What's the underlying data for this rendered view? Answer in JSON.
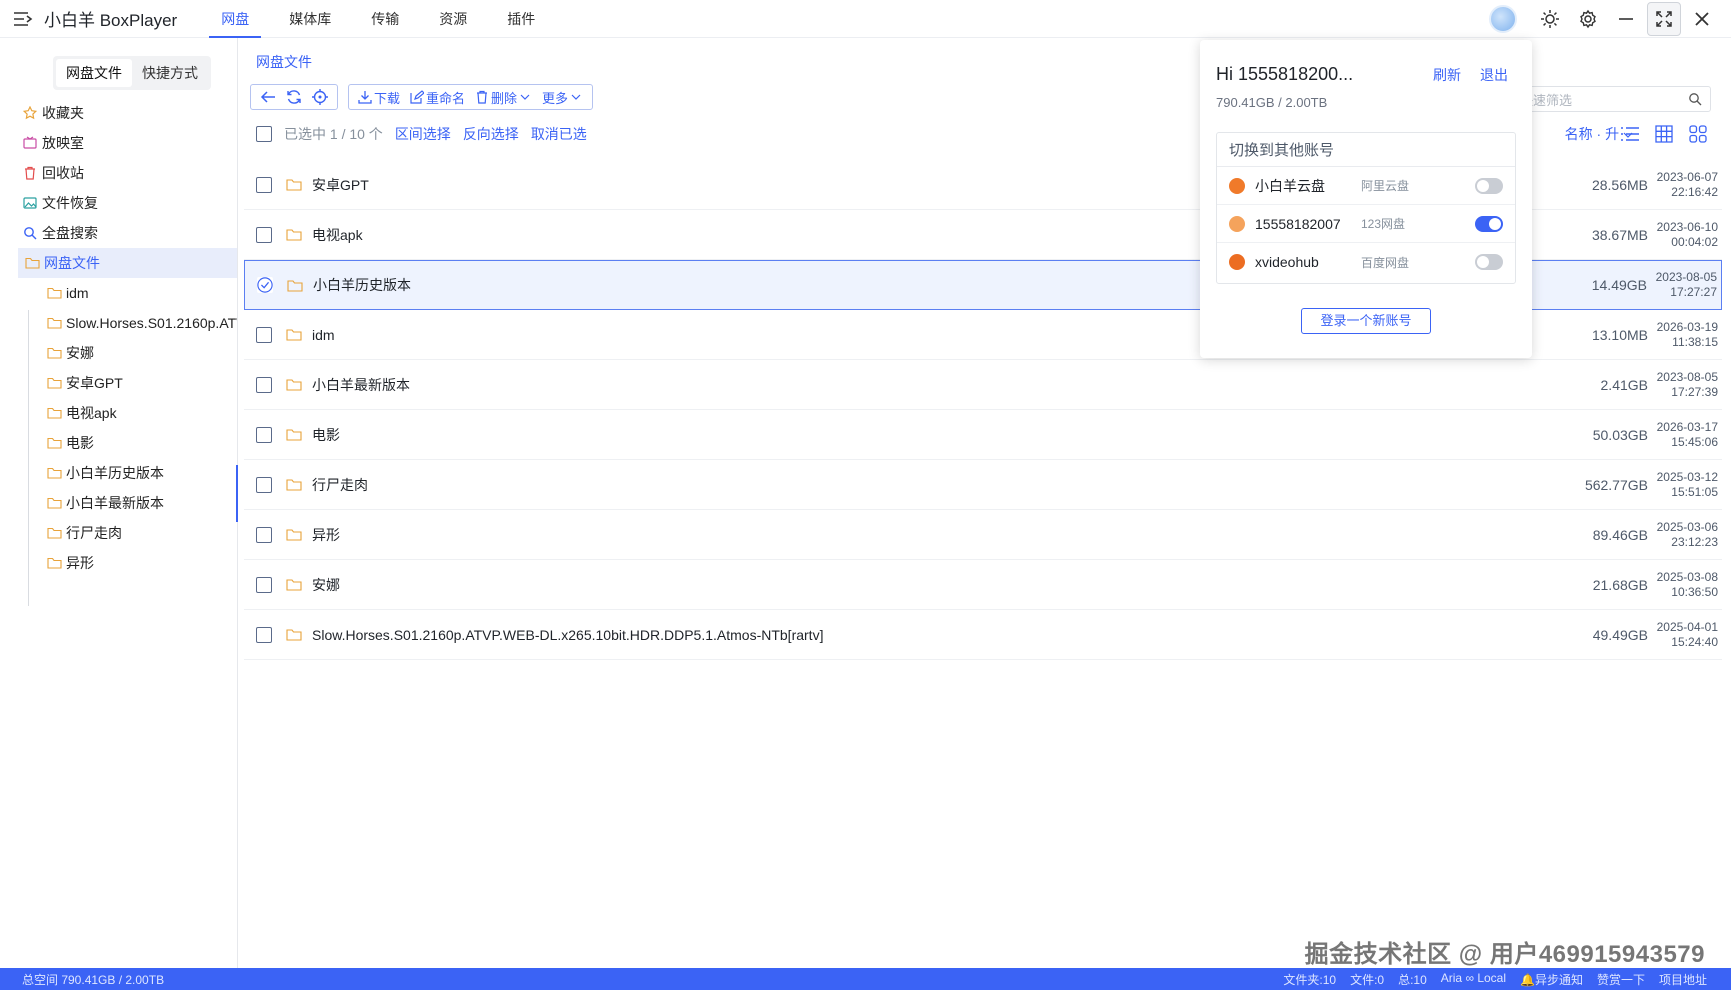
{
  "app": {
    "title": "小白羊 BoxPlayer"
  },
  "topnav": [
    "网盘",
    "媒体库",
    "传输",
    "资源",
    "插件"
  ],
  "sidebar": {
    "tabs": [
      "网盘文件",
      "快捷方式"
    ],
    "quick": [
      "收藏夹",
      "放映室",
      "回收站",
      "文件恢复",
      "全盘搜索"
    ],
    "root": "网盘文件",
    "folders": [
      "idm",
      "Slow.Horses.S01.2160p.ATVP.WEB-DL.x265.10bit.HDR.DDP5.1.Atmos-NTb[rartv]",
      "安娜",
      "安卓GPT",
      "电视apk",
      "电影",
      "小白羊历史版本",
      "小白羊最新版本",
      "行尸走肉",
      "异形"
    ]
  },
  "breadcrumb": "网盘文件",
  "toolbar": {
    "download": "下载",
    "rename": "重命名",
    "delete": "删除",
    "more": "更多"
  },
  "search": {
    "placeholder": "快速筛选"
  },
  "selection": {
    "count": "已选中 1 / 10 个",
    "range": "区间选择",
    "invert": "反向选择",
    "cancel": "取消已选"
  },
  "sort": "名称 · 升",
  "files": [
    {
      "name": "安卓GPT",
      "size": "28.56MB",
      "date": "2023-06-07",
      "time": "22:16:42",
      "selected": false
    },
    {
      "name": "电视apk",
      "size": "38.67MB",
      "date": "2023-06-10",
      "time": "00:04:02",
      "selected": false
    },
    {
      "name": "小白羊历史版本",
      "size": "14.49GB",
      "date": "2023-08-05",
      "time": "17:27:27",
      "selected": true
    },
    {
      "name": "idm",
      "size": "13.10MB",
      "date": "2026-03-19",
      "time": "11:38:15",
      "selected": false
    },
    {
      "name": "小白羊最新版本",
      "size": "2.41GB",
      "date": "2023-08-05",
      "time": "17:27:39",
      "selected": false
    },
    {
      "name": "电影",
      "size": "50.03GB",
      "date": "2026-03-17",
      "time": "15:45:06",
      "selected": false
    },
    {
      "name": "行尸走肉",
      "size": "562.77GB",
      "date": "2025-03-12",
      "time": "15:51:05",
      "selected": false
    },
    {
      "name": "异形",
      "size": "89.46GB",
      "date": "2025-03-06",
      "time": "23:12:23",
      "selected": false
    },
    {
      "name": "安娜",
      "size": "21.68GB",
      "date": "2025-03-08",
      "time": "10:36:50",
      "selected": false
    },
    {
      "name": "Slow.Horses.S01.2160p.ATVP.WEB-DL.x265.10bit.HDR.DDP5.1.Atmos-NTb[rartv]",
      "size": "49.49GB",
      "date": "2025-04-01",
      "time": "15:24:40",
      "selected": false
    }
  ],
  "account_popup": {
    "greeting": "Hi 1555818200...",
    "refresh": "刷新",
    "logout": "退出",
    "quota": "790.41GB / 2.00TB",
    "switch_title": "切换到其他账号",
    "accounts": [
      {
        "name": "小白羊云盘",
        "type": "阿里云盘",
        "active": false,
        "color": "#f07a2a"
      },
      {
        "name": "15558182007",
        "type": "123网盘",
        "active": true,
        "color": "#f5a35c"
      },
      {
        "name": "xvideohub",
        "type": "百度网盘",
        "active": false,
        "color": "#ec6d22"
      }
    ],
    "login_new": "登录一个新账号"
  },
  "watermark": "掘金技术社区 @ 用户469915943579",
  "statusbar": {
    "space": "总空间 790.41GB / 2.00TB",
    "folders": "文件夹:10",
    "files": "文件:0",
    "total": "总:10",
    "aria": "Aria ∞ Local",
    "notify": "🔔异步通知",
    "like": "赞赏一下",
    "project": "项目地址"
  },
  "colors": {
    "accent": "#3b63f5",
    "folder": "#e8a33a"
  }
}
